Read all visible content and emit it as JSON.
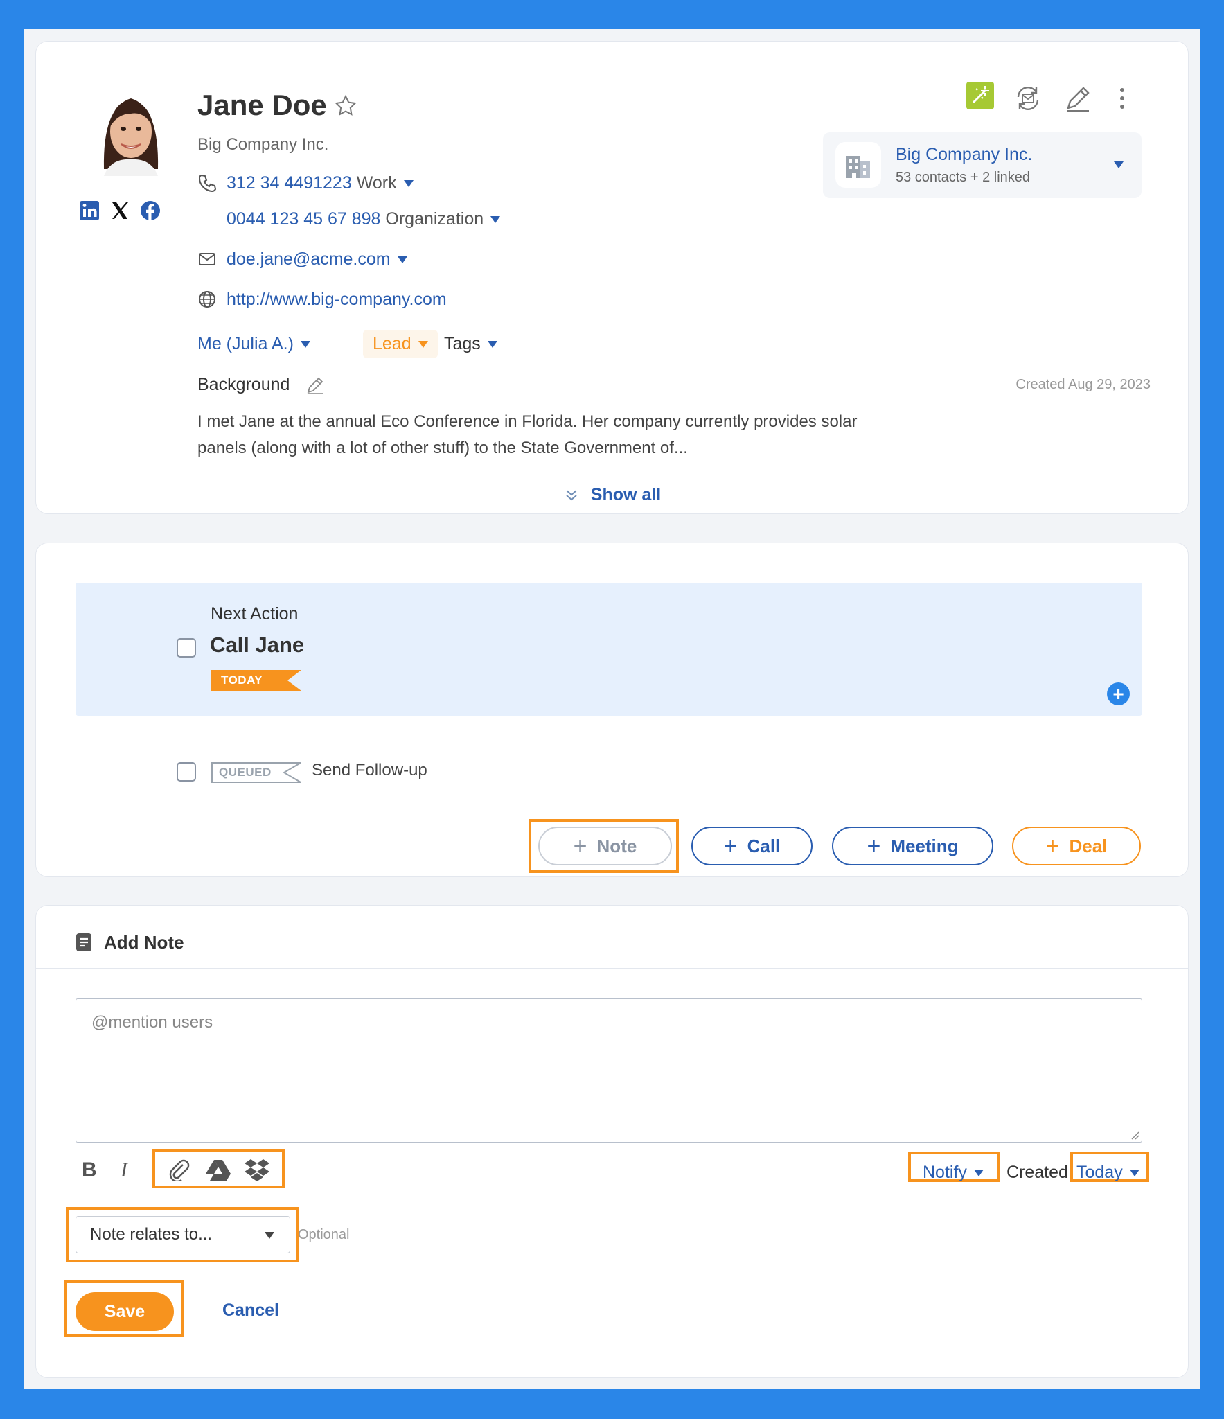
{
  "colors": {
    "frame": "#2a86e8",
    "accent": "#2a5db0",
    "orange": "#f7931e",
    "magic": "#a6c934",
    "panel": "#e6f0fd"
  },
  "contact": {
    "name": "Jane Doe",
    "company": "Big Company Inc.",
    "phones": [
      {
        "number": "312 34 4491223",
        "label": "Work"
      },
      {
        "number": "0044 123 45 67 898",
        "label": "Organization"
      }
    ],
    "email": "doe.jane@acme.com",
    "website": "http://www.big-company.com",
    "owner": "Me (Julia A.)",
    "status": "Lead",
    "tags": "Tags",
    "background_title": "Background",
    "background_text": "I met Jane at the annual Eco Conference in Florida. Her company currently provides solar panels (along with a lot of other stuff) to the State Government of...",
    "created": "Created Aug 29, 2023",
    "show_all": "Show all",
    "social_icons": [
      "linkedin-icon",
      "x-icon",
      "facebook-icon"
    ]
  },
  "company_box": {
    "name": "Big Company Inc.",
    "sub": "53 contacts + 2 linked"
  },
  "actions": {
    "next_action_label": "Next Action",
    "next_action_title": "Call Jane",
    "today_badge": "TODAY",
    "queued_badge": "QUEUED",
    "queued_title": "Send Follow-up",
    "buttons": {
      "note": "Note",
      "call": "Call",
      "meeting": "Meeting",
      "deal": "Deal"
    }
  },
  "note_form": {
    "title": "Add Note",
    "placeholder": "@mention users",
    "notify": "Notify",
    "created_label": "Created",
    "created_value": "Today",
    "relates_placeholder": "Note relates to...",
    "optional": "Optional",
    "save": "Save",
    "cancel": "Cancel"
  }
}
